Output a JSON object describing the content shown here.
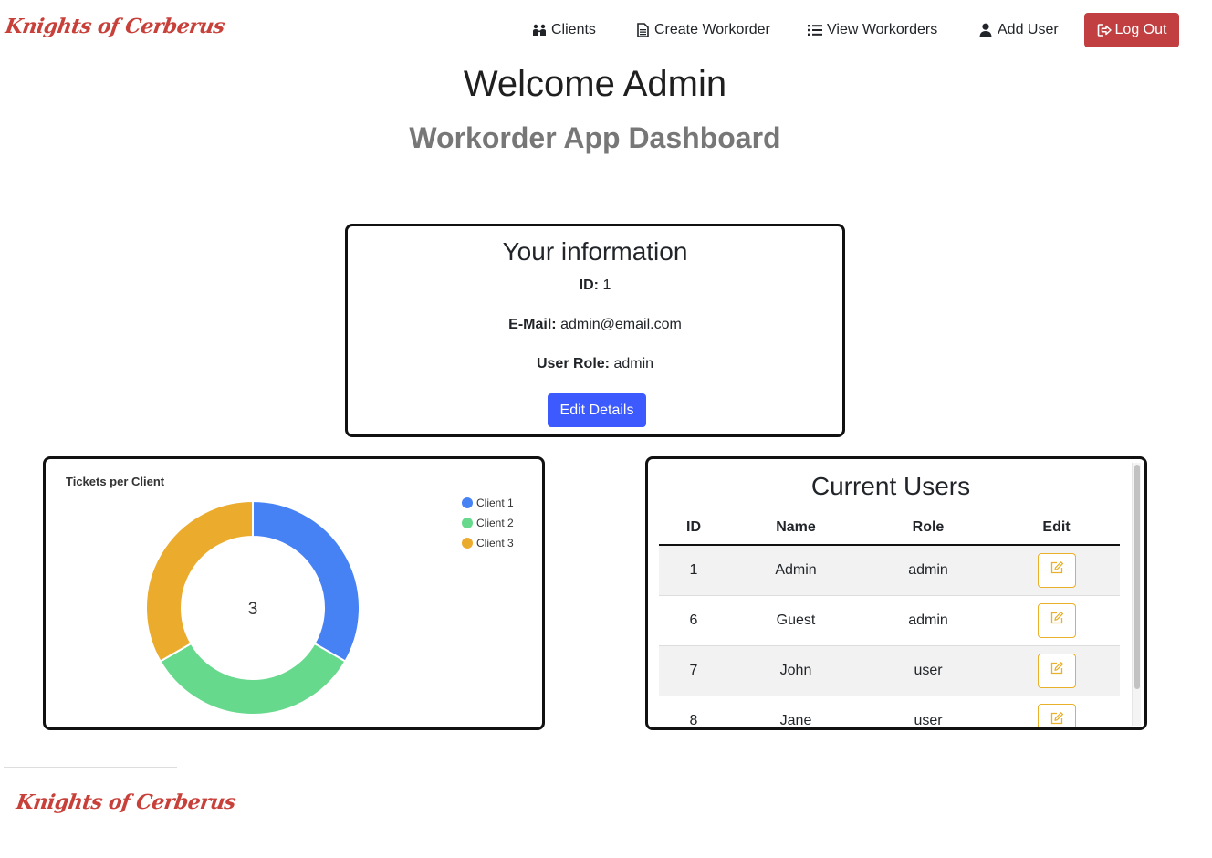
{
  "brand": {
    "name": "Knights of Cerberus",
    "color": "#c8403a"
  },
  "nav": {
    "items": [
      {
        "label": "Clients",
        "icon": "people-icon"
      },
      {
        "label": "Create Workorder",
        "icon": "document-icon"
      },
      {
        "label": "View Workorders",
        "icon": "list-icon"
      },
      {
        "label": "Add User",
        "icon": "user-icon"
      }
    ],
    "logout": {
      "label": "Log Out",
      "icon": "logout-icon",
      "color": "#c13f40"
    }
  },
  "header": {
    "welcome": "Welcome Admin",
    "subtitle": "Workorder App Dashboard"
  },
  "info": {
    "title": "Your information",
    "id_label": "ID:",
    "id_value": "1",
    "email_label": "E-Mail:",
    "email_value": "admin@email.com",
    "role_label": "User Role:",
    "role_value": "admin",
    "edit_button": "Edit Details",
    "accent": "#3d5afe"
  },
  "chart_data": {
    "type": "pie",
    "title": "Tickets per Client",
    "categories": [
      "Client 1",
      "Client 2",
      "Client 3"
    ],
    "values": [
      1,
      1,
      1
    ],
    "colors": [
      "#4782f5",
      "#66d98d",
      "#ebab2d"
    ],
    "center_label": "3",
    "legend": "top-right",
    "donut": true
  },
  "users": {
    "title": "Current Users",
    "columns": [
      "ID",
      "Name",
      "Role",
      "Edit"
    ],
    "rows": [
      {
        "id": "1",
        "name": "Admin",
        "role": "admin"
      },
      {
        "id": "6",
        "name": "Guest",
        "role": "admin"
      },
      {
        "id": "7",
        "name": "John",
        "role": "user"
      },
      {
        "id": "8",
        "name": "Jane",
        "role": "user"
      }
    ],
    "edit_icon": "edit-icon",
    "edit_color": "#e9b02a"
  }
}
